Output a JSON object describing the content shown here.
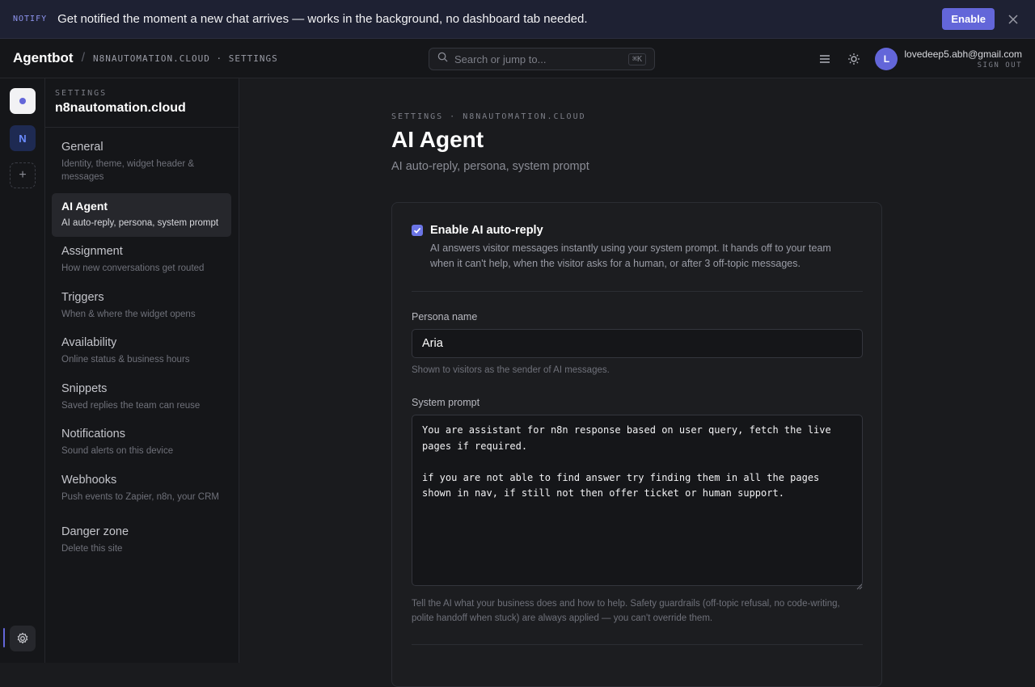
{
  "notify": {
    "tag": "NOTIFY",
    "text": "Get notified the moment a new chat arrives — works in the background, no dashboard tab needed.",
    "enable_label": "Enable",
    "close_icon": "close-icon"
  },
  "topbar": {
    "brand": "Agentbot",
    "separator": "/",
    "breadcrumb": "N8NAUTOMATION.CLOUD · SETTINGS",
    "search": {
      "placeholder": "Search or jump to...",
      "shortcut": "⌘K"
    },
    "user": {
      "avatar_initial": "L",
      "email": "lovedeep5.abh@gmail.com",
      "sign_out": "SIGN OUT"
    }
  },
  "rail": {
    "sites": [
      {
        "name": "current-site",
        "initial": ""
      },
      {
        "name": "n8n-site",
        "initial": "N"
      }
    ],
    "add": "+"
  },
  "sidebar": {
    "kicker": "SETTINGS",
    "title": "n8nautomation.cloud",
    "items": [
      {
        "label": "General",
        "desc": "Identity, theme, widget header & messages",
        "active": false
      },
      {
        "label": "AI Agent",
        "desc": "AI auto-reply, persona, system prompt",
        "active": true
      },
      {
        "label": "Assignment",
        "desc": "How new conversations get routed",
        "active": false
      },
      {
        "label": "Triggers",
        "desc": "When & where the widget opens",
        "active": false
      },
      {
        "label": "Availability",
        "desc": "Online status & business hours",
        "active": false
      },
      {
        "label": "Snippets",
        "desc": "Saved replies the team can reuse",
        "active": false
      },
      {
        "label": "Notifications",
        "desc": "Sound alerts on this device",
        "active": false
      },
      {
        "label": "Webhooks",
        "desc": "Push events to Zapier, n8n, your CRM",
        "active": false
      },
      {
        "label": "Danger zone",
        "desc": "Delete this site",
        "active": false
      }
    ]
  },
  "main": {
    "kicker": "SETTINGS · N8NAUTOMATION.CLOUD",
    "title": "AI Agent",
    "subtitle": "AI auto-reply, persona, system prompt",
    "auto_reply": {
      "checked": true,
      "label": "Enable AI auto-reply",
      "desc": "AI answers visitor messages instantly using your system prompt. It hands off to your team when it can't help, when the visitor asks for a human, or after 3 off-topic messages."
    },
    "persona": {
      "label": "Persona name",
      "value": "Aria",
      "hint": "Shown to visitors as the sender of AI messages."
    },
    "system_prompt": {
      "label": "System prompt",
      "value": "You are assistant for n8n response based on user query, fetch the live pages if required.\n\nif you are not able to find answer try finding them in all the pages shown in nav, if still not then offer ticket or human support.",
      "hint": "Tell the AI what your business does and how to help. Safety guardrails (off-topic refusal, no code-writing, polite handoff when stuck) are always applied — you can't override them."
    }
  },
  "colors": {
    "accent": "#6366d9",
    "background": "#1a1b1e",
    "panel": "#151619"
  }
}
